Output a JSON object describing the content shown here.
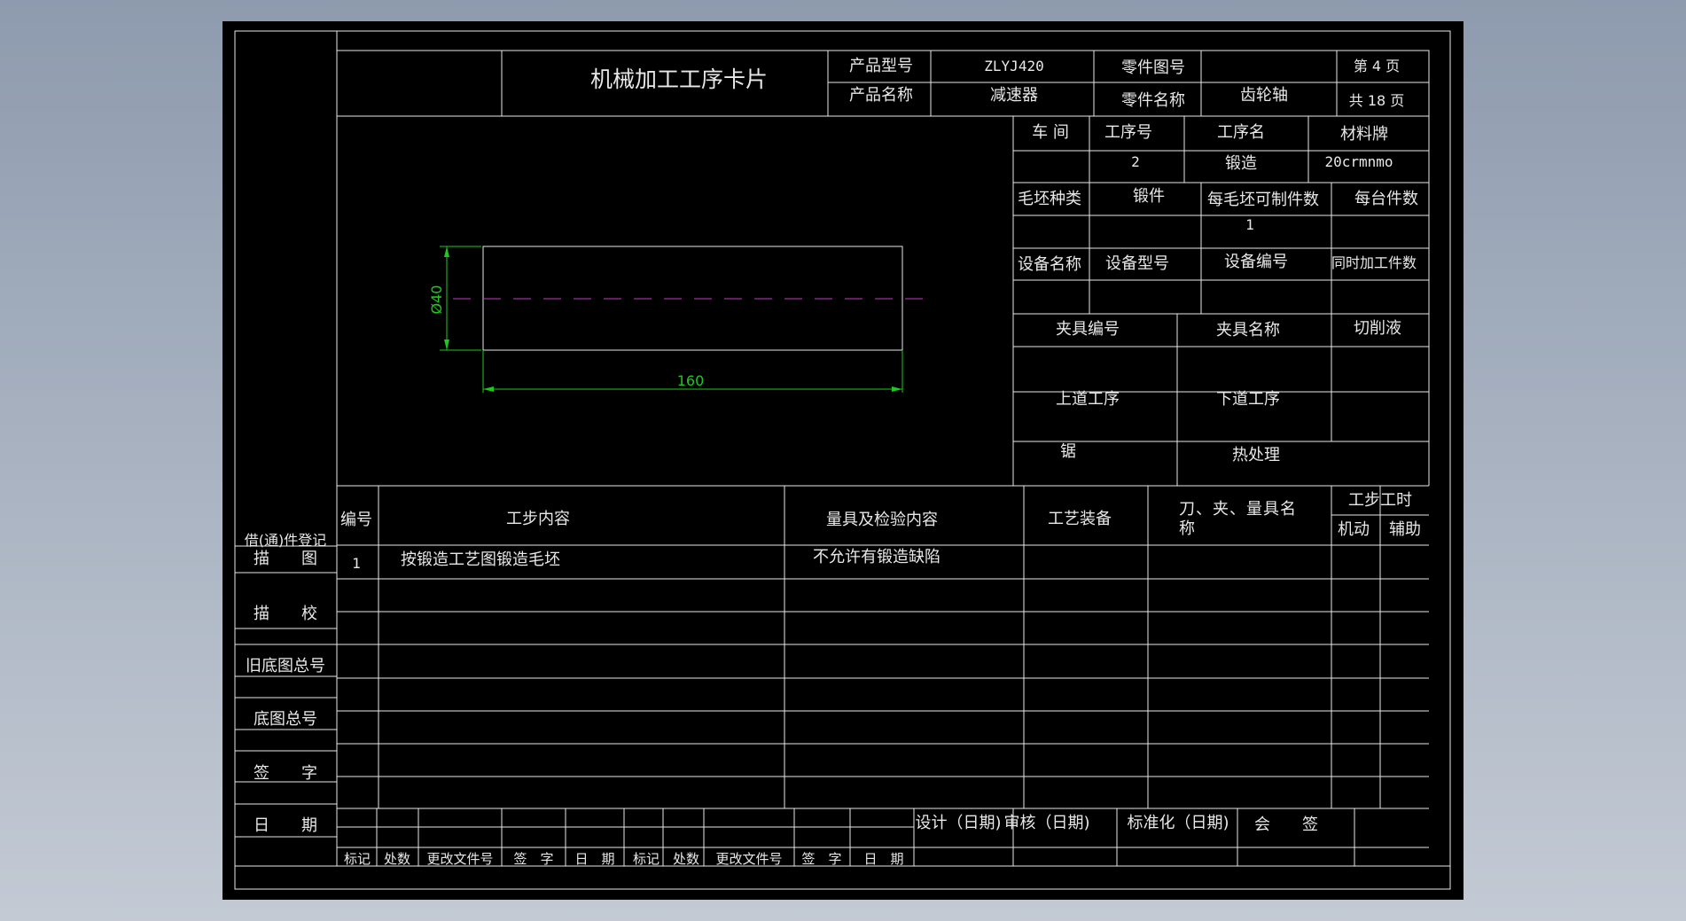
{
  "colors": {
    "background_top": "#8e9bae",
    "sheet": "#000000",
    "line": "#e8e8e8",
    "dimension": "#1ec81e",
    "centerline": "#c33cc3"
  },
  "header": {
    "title": "机械加工工序卡片",
    "product_model_label": "产品型号",
    "product_model_value": "ZLYJ420",
    "product_name_label": "产品名称",
    "product_name_value": "减速器",
    "part_drawing_no_label": "零件图号",
    "part_drawing_no_value": "",
    "part_name_label": "零件名称",
    "part_name_value": "齿轮轴",
    "page_label": "第 4 页",
    "total_label": "共 18 页"
  },
  "process_info": {
    "workshop_label": "车 间",
    "op_no_label": "工序号",
    "op_name_label": "工序名",
    "material_label": "材料牌",
    "workshop_value": "",
    "op_no_value": "2",
    "op_name_value": "锻造",
    "material_value": "20crmnmo",
    "blank_type_label": "毛坯种类",
    "blank_type_value": "锻件",
    "per_blank_label": "每毛坯可制件数",
    "per_blank_value": "1",
    "per_unit_label": "每台件数",
    "equip_name_label": "设备名称",
    "equip_model_label": "设备型号",
    "equip_no_label": "设备编号",
    "simul_label": "同时加工件数",
    "fixture_no_label": "夹具编号",
    "fixture_name_label": "夹具名称",
    "coolant_label": "切削液",
    "prev_op_label": "上道工序",
    "next_op_label": "下道工序",
    "prev_op_value": "锯",
    "next_op_value": "热处理"
  },
  "sketch": {
    "diameter_label": "Ø40",
    "length_label": "160"
  },
  "steps": {
    "headers": {
      "no": "编号",
      "content": "工步内容",
      "inspection": "量具及检验内容",
      "equipment": "工艺装备",
      "tools": "刀、夹、量具名称",
      "time": "工步工时",
      "machine": "机动",
      "aux": "辅助"
    },
    "rows": [
      {
        "no": "1",
        "content": "按锻造工艺图锻造毛坯",
        "inspection": "不允许有锻造缺陷"
      }
    ]
  },
  "side": [
    "借(通)件登记",
    "描　　图",
    "描　　校",
    "旧底图总号",
    "底图总号",
    "签　　字",
    "日　　期"
  ],
  "footer": {
    "revision_labels": [
      "标记",
      "处数",
      "更改文件号",
      "签　字",
      "日　期",
      "标记",
      "处数",
      "更改文件号",
      "签　字",
      "日　期"
    ],
    "design": "设计（日期)",
    "review": "审核（日期)",
    "standard": "标准化（日期)",
    "sign": "会　　签"
  }
}
